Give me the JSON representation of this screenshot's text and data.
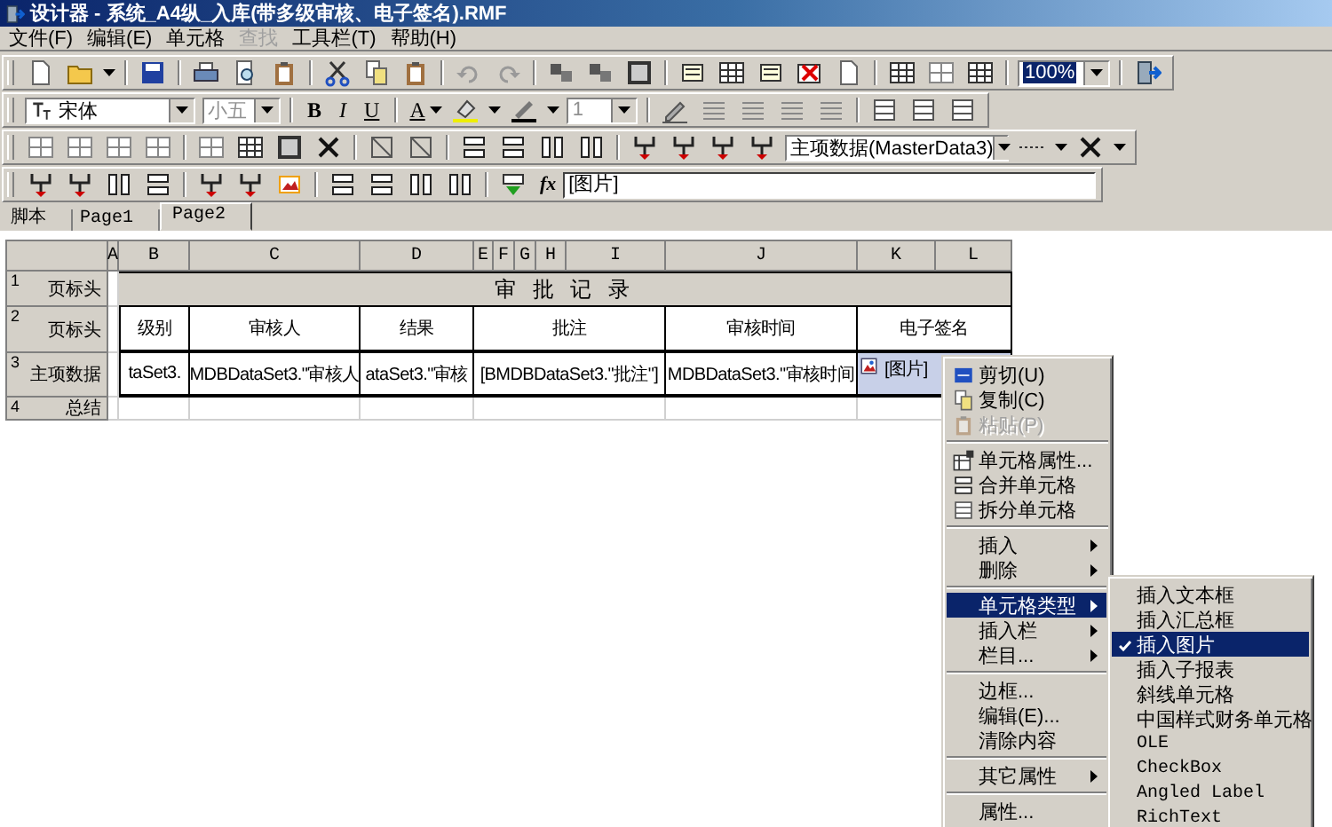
{
  "window": {
    "title": "设计器 - 系统_A4纵_入库(带多级审核、电子签名).RMF"
  },
  "menu": [
    {
      "label": "文件(F)",
      "disabled": false
    },
    {
      "label": "编辑(E)",
      "disabled": false
    },
    {
      "label": "单元格",
      "disabled": false
    },
    {
      "label": "查找",
      "disabled": true
    },
    {
      "label": "工具栏(T)",
      "disabled": false
    },
    {
      "label": "帮助(H)",
      "disabled": false
    }
  ],
  "toolbar": {
    "zoom": "100%",
    "font": "宋体",
    "font_size": {
      "value": "小五",
      "disabled": true
    },
    "format_buttons": [
      "B",
      "I",
      "U"
    ],
    "font_color_button": "A",
    "line_width": {
      "value": "1",
      "disabled": true
    },
    "dataset": "主项数据(MasterData3)"
  },
  "formula_bar": {
    "label": "fx",
    "value": "[图片]"
  },
  "tabs": [
    {
      "label": "脚本",
      "selected": false
    },
    {
      "label": "Page1",
      "selected": false
    },
    {
      "label": "Page2",
      "selected": true
    }
  ],
  "column_letters": [
    "A",
    "B",
    "C",
    "D",
    "E",
    "F",
    "G",
    "H",
    "I",
    "J",
    "K",
    "L"
  ],
  "grid": {
    "rows": [
      {
        "number": "1",
        "label": "页标头",
        "cells": [
          "",
          "",
          "",
          "",
          {
            "kind": "title",
            "text": "审 批 记 录",
            "selected": false
          },
          "",
          ""
        ]
      },
      {
        "number": "2",
        "label": "页标头",
        "cells": [
          {
            "kind": "blank",
            "selected": false
          },
          {
            "kind": "header",
            "text": "级别",
            "selected": false
          },
          {
            "kind": "header",
            "text": "审核人",
            "selected": false
          },
          {
            "kind": "header",
            "text": "结果",
            "selected": false
          },
          {
            "kind": "header",
            "text": "批注",
            "selected": false
          },
          {
            "kind": "header",
            "text": "审核时间",
            "selected": false
          },
          {
            "kind": "header",
            "text": "电子签名",
            "selected": false
          }
        ]
      },
      {
        "number": "3",
        "label": "主项数据",
        "cells": [
          {
            "kind": "blank",
            "selected": false
          },
          {
            "kind": "data",
            "text": "taSet3.",
            "selected": false
          },
          {
            "kind": "data",
            "text": "MDBDataSet3.\"审核人",
            "selected": false
          },
          {
            "kind": "data",
            "text": "ataSet3.\"审核",
            "selected": false
          },
          {
            "kind": "data",
            "text": "[BMDBDataSet3.\"批注\"]",
            "selected": false
          },
          {
            "kind": "data",
            "text": "MDBDataSet3.\"审核时间",
            "selected": false
          },
          {
            "kind": "image",
            "text": "[图片]",
            "selected": true
          }
        ]
      },
      {
        "number": "4",
        "label": "总结",
        "cells": [
          {
            "kind": "blank",
            "selected": false
          },
          {
            "kind": "blank",
            "selected": false
          },
          {
            "kind": "blank",
            "selected": false
          },
          {
            "kind": "blank",
            "selected": false
          },
          {
            "kind": "blank",
            "selected": false
          },
          {
            "kind": "blank",
            "selected": false
          },
          {
            "kind": "blank",
            "selected": false
          }
        ]
      }
    ]
  },
  "context_menu": {
    "items": [
      {
        "kind": "item",
        "label": "剪切(U)",
        "disabled": false,
        "submenu": false,
        "selected": false
      },
      {
        "kind": "item",
        "label": "复制(C)",
        "disabled": false,
        "submenu": false,
        "selected": false
      },
      {
        "kind": "item",
        "label": "粘贴(P)",
        "disabled": true,
        "submenu": false,
        "selected": false
      },
      {
        "kind": "separator"
      },
      {
        "kind": "item",
        "label": "单元格属性...",
        "disabled": false,
        "submenu": false,
        "selected": false
      },
      {
        "kind": "item",
        "label": "合并单元格",
        "disabled": false,
        "submenu": false,
        "selected": false
      },
      {
        "kind": "item",
        "label": "拆分单元格",
        "disabled": false,
        "submenu": false,
        "selected": false
      },
      {
        "kind": "separator"
      },
      {
        "kind": "item",
        "label": "插入",
        "disabled": false,
        "submenu": true,
        "selected": false
      },
      {
        "kind": "item",
        "label": "删除",
        "disabled": false,
        "submenu": true,
        "selected": false
      },
      {
        "kind": "separator"
      },
      {
        "kind": "item",
        "label": "单元格类型",
        "disabled": false,
        "submenu": true,
        "selected": true
      },
      {
        "kind": "item",
        "label": "插入栏",
        "disabled": false,
        "submenu": true,
        "selected": false
      },
      {
        "kind": "item",
        "label": "栏目...",
        "disabled": false,
        "submenu": true,
        "selected": false
      },
      {
        "kind": "separator"
      },
      {
        "kind": "item",
        "label": "边框...",
        "disabled": false,
        "submenu": false,
        "selected": false
      },
      {
        "kind": "item",
        "label": "编辑(E)...",
        "disabled": false,
        "submenu": false,
        "selected": false
      },
      {
        "kind": "item",
        "label": "清除内容",
        "disabled": false,
        "submenu": false,
        "selected": false
      },
      {
        "kind": "separator"
      },
      {
        "kind": "item",
        "label": "其它属性",
        "disabled": false,
        "submenu": true,
        "selected": false
      },
      {
        "kind": "separator"
      },
      {
        "kind": "item",
        "label": "属性...",
        "disabled": false,
        "submenu": false,
        "selected": false
      }
    ]
  },
  "submenu": {
    "items": [
      {
        "label": "插入文本框",
        "checked": false,
        "selected": false
      },
      {
        "label": "插入汇总框",
        "checked": false,
        "selected": false
      },
      {
        "label": "插入图片",
        "checked": true,
        "selected": true
      },
      {
        "label": "插入子报表",
        "checked": false,
        "selected": false
      },
      {
        "label": "斜线单元格",
        "checked": false,
        "selected": false
      },
      {
        "label": "中国样式财务单元格",
        "checked": false,
        "selected": false
      },
      {
        "label": "OLE",
        "checked": false,
        "selected": false
      },
      {
        "label": "CheckBox",
        "checked": false,
        "selected": false
      },
      {
        "label": "Angled Label",
        "checked": false,
        "selected": false
      },
      {
        "label": "RichText",
        "checked": false,
        "selected": false
      }
    ]
  }
}
